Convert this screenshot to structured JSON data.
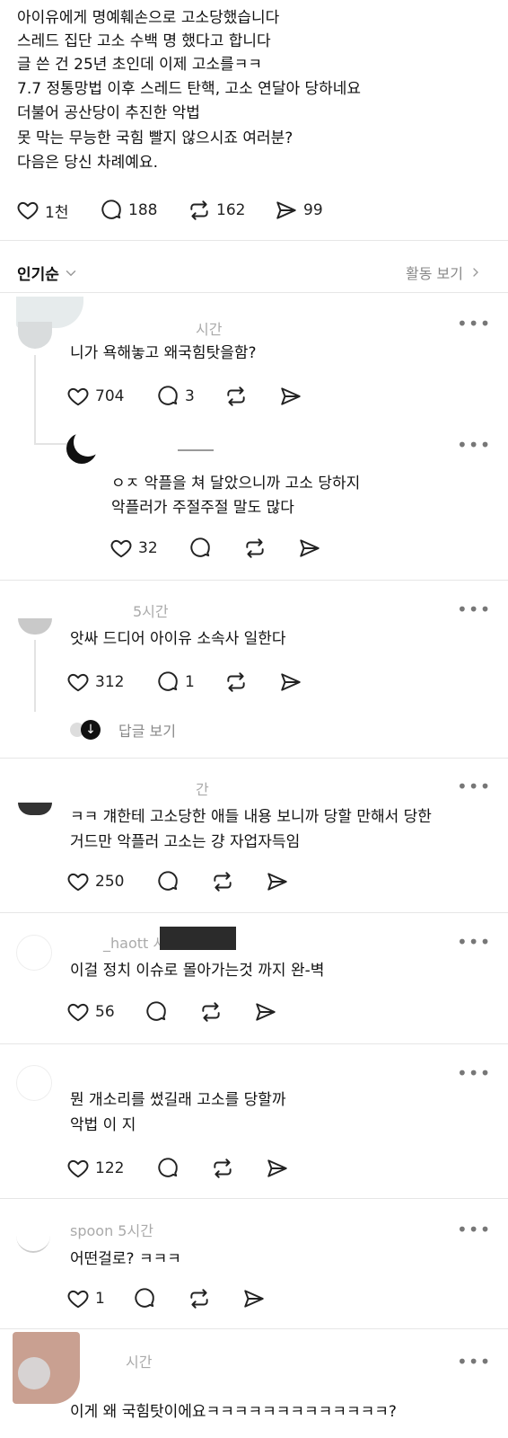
{
  "post": {
    "lines": [
      "아이유에게 명예훼손으로 고소당했습니다",
      "스레드 집단 고소 수백 명 했다고 합니다",
      "글 쓴 건 25년 초인데 이제 고소를ㅋㅋ",
      "7.7 정통망법 이후 스레드 탄핵, 고소 연달아 당하네요",
      "더불어 공산당이 추진한 악법",
      "못 막는 무능한 국힘 빨지 않으시죠 여러분?",
      "다음은 당신 차례예요."
    ],
    "stats": {
      "likes": "1천",
      "comments": "188",
      "reposts": "162",
      "shares": "99"
    }
  },
  "sort": {
    "label": "인기순",
    "activity": "활동 보기"
  },
  "comments": [
    {
      "meta": "시간",
      "text": [
        "니가 욕해놓고 왜국힘탓을함?"
      ],
      "likes": "704",
      "replies": "3"
    },
    {
      "meta": "",
      "text": [
        "ㅇㅈ 악플을 쳐 달았으니까 고소 당하지",
        "악플러가 주절주절 말도 많다"
      ],
      "likes": "32",
      "replies": ""
    },
    {
      "meta": "5시간",
      "text": [
        "앗싸 드디어 아이유 소속사 일한다"
      ],
      "likes": "312",
      "replies": "1",
      "view_replies": "답글 보기"
    },
    {
      "meta": "간",
      "text": [
        "ㅋㅋ 걔한테 고소당한 애들 내용 보니까 당할 만해서 당한",
        "거드만 악플러 고소는 걍 자업자득임"
      ],
      "likes": "250",
      "replies": ""
    },
    {
      "meta": "_haott 시간",
      "text": [
        "이걸 정치 이슈로 몰아가는것 까지 완-벽"
      ],
      "likes": "56",
      "replies": ""
    },
    {
      "meta": "",
      "text": [
        "뭔 개소리를 썼길래 고소를 당할까",
        "악법 이 지"
      ],
      "likes": "122",
      "replies": ""
    },
    {
      "meta": "spoon 5시간",
      "text": [
        "어떤걸로? ㅋㅋㅋ"
      ],
      "likes": "1",
      "replies": ""
    },
    {
      "meta": "시간",
      "text": [
        "이게 왜 국힘탓이에요ㅋㅋㅋㅋㅋㅋㅋㅋㅋㅋㅋㅋㅋ?"
      ]
    }
  ],
  "icons": {
    "like": "heart-icon",
    "comment": "comment-bubble-icon",
    "repost": "repost-icon",
    "share": "send-icon",
    "more": "more-dots-icon",
    "chevron": "chevron-down-icon",
    "arrow": "chevron-right-icon"
  },
  "colors": {
    "text": "#111111",
    "muted": "#888888",
    "divider": "#e6e6e6"
  }
}
